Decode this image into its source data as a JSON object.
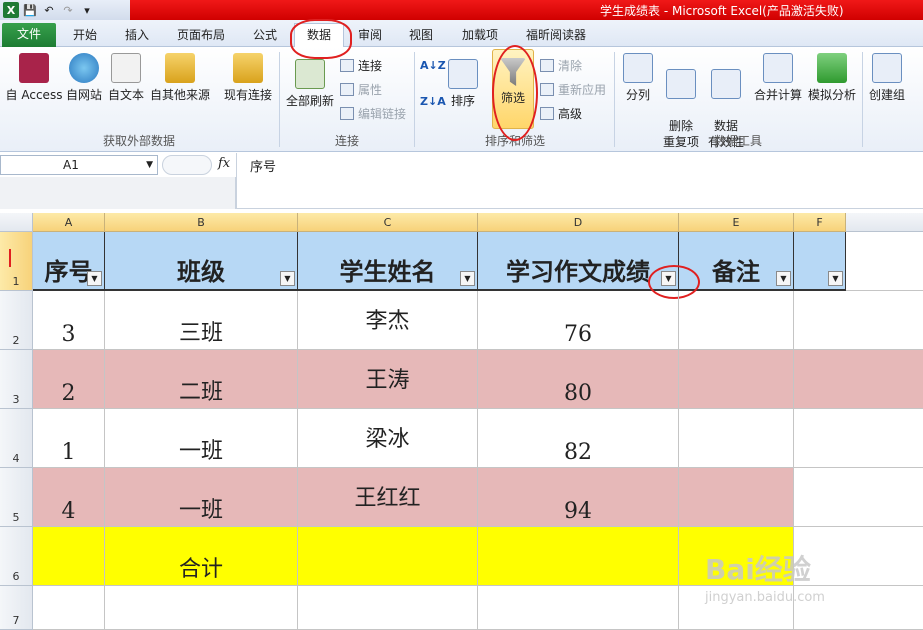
{
  "window": {
    "title": "学生成绩表 - Microsoft Excel(产品激活失败)",
    "app_icon": "excel-icon"
  },
  "tabs": [
    "文件",
    "开始",
    "插入",
    "页面布局",
    "公式",
    "数据",
    "审阅",
    "视图",
    "加载项",
    "福昕阅读器"
  ],
  "active_tab": "数据",
  "ribbon": {
    "group_external": {
      "label": "获取外部数据",
      "buttons": [
        "自 Access",
        "自网站",
        "自文本",
        "自其他来源",
        "现有连接"
      ]
    },
    "group_connections": {
      "label": "连接",
      "refresh": "全部刷新",
      "small": [
        "连接",
        "属性",
        "编辑链接"
      ]
    },
    "group_sort": {
      "label": "排序和筛选",
      "sort": "排序",
      "filter": "筛选",
      "small": [
        "清除",
        "重新应用",
        "高级"
      ]
    },
    "group_tools": {
      "label": "数据工具",
      "buttons": [
        "分列",
        "删除\n重复项",
        "数据\n有效性",
        "合并计算",
        "模拟分析"
      ]
    },
    "group_outline": {
      "buttons": [
        "创建组"
      ]
    }
  },
  "formula_bar": {
    "name_box": "A1",
    "fx": "fx",
    "content": "序号"
  },
  "columns": [
    "A",
    "B",
    "C",
    "D",
    "E",
    "F"
  ],
  "rows": [
    "1",
    "2",
    "3",
    "4",
    "5",
    "6",
    "7"
  ],
  "table": {
    "headers": [
      "序号",
      "班级",
      "学生姓名",
      "学习作文成绩",
      "备注",
      ""
    ],
    "data": [
      [
        "3",
        "三班",
        "李杰",
        "76",
        ""
      ],
      [
        "2",
        "二班",
        "王涛",
        "80",
        ""
      ],
      [
        "1",
        "一班",
        "梁冰",
        "82",
        ""
      ],
      [
        "4",
        "一班",
        "王红红",
        "94",
        ""
      ]
    ],
    "total": [
      "",
      "合计",
      "",
      "",
      ""
    ]
  },
  "watermark": {
    "brand": "Bai经验",
    "url": "jingyan.baidu.com"
  }
}
